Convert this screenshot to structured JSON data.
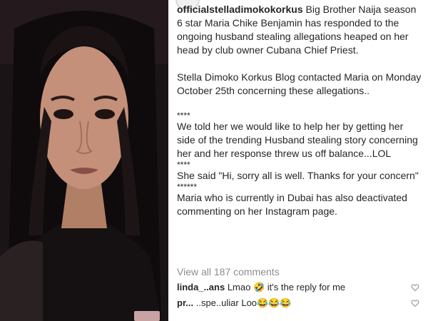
{
  "post": {
    "photo_icon": "profile-photo",
    "caption": {
      "username": "officialstelladimokokorkus",
      "para1": "Big Brother Naija season 6 star Maria Chike Benjamin has responded to the ongoing husband stealing allegations heaped on her head by club owner Cubana Chief Priest.",
      "para2": "Stella Dimoko Korkus Blog contacted Maria on Monday October 25th concerning these allegations..",
      "sep1": "****",
      "para3": "We told her we would like to help her by getting her side of the trending Husband stealing story concerning her and her response threw us off balance...LOL",
      "sep2": "****",
      "para4": "She said \"Hi, sorry all is well. Thanks for your concern\"",
      "sep3": "******",
      "para5": "Maria who is currently in Dubai has also deactivated commenting on her Instagram page."
    },
    "view_all_comments": "View all 187 comments",
    "comments": [
      {
        "user": "linda_..ans",
        "text": "Lmao 🤣 it's the reply for me",
        "like_icon": "heart-icon"
      },
      {
        "user": "pr...",
        "text": "..spe..uliar Loo😂😂😂",
        "like_icon": "heart-icon"
      }
    ]
  }
}
